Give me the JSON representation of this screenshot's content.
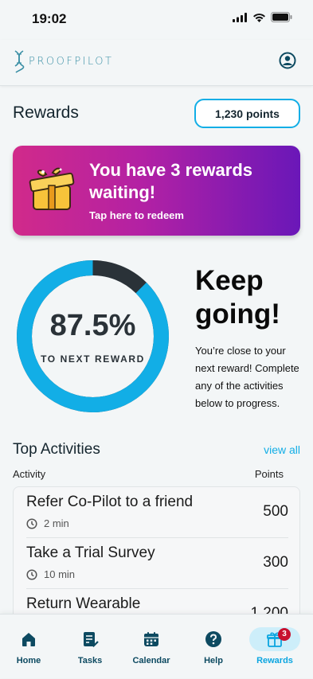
{
  "status_bar": {
    "time": "19:02",
    "icons": [
      "cellular-icon",
      "wifi-icon",
      "battery-icon"
    ]
  },
  "app_bar": {
    "logo_text": "PROOFPILOT",
    "profile_icon": "profile-icon"
  },
  "rewards": {
    "title": "Rewards",
    "points": "1,230 points"
  },
  "banner": {
    "title": "You have 3 rewards waiting!",
    "subtitle": "Tap here to redeem",
    "icon": "gift-icon"
  },
  "progress": {
    "percent_label": "87.5%",
    "value": 0.875,
    "caption": "TO NEXT REWARD",
    "headline": "Keep going!",
    "description": "You’re close to your next reward! Complete any of the activities below to progress."
  },
  "top_activities": {
    "title": "Top Activities",
    "view_all": "view all",
    "col_activity": "Activity",
    "col_points": "Points",
    "items": [
      {
        "title": "Refer Co-Pilot to a friend",
        "time": "2 min",
        "points": "500"
      },
      {
        "title": "Take a Trial Survey",
        "time": "10 min",
        "points": "300"
      },
      {
        "title": "Return Wearable",
        "time": "",
        "points": "1,200"
      }
    ]
  },
  "bottom_nav": {
    "items": [
      {
        "label": "Home",
        "icon": "home-icon"
      },
      {
        "label": "Tasks",
        "icon": "tasks-icon"
      },
      {
        "label": "Calendar",
        "icon": "calendar-icon"
      },
      {
        "label": "Help",
        "icon": "help-icon"
      },
      {
        "label": "Rewards",
        "icon": "gift-icon"
      }
    ],
    "rewards_badge": "3"
  },
  "colors": {
    "accent": "#12aee6",
    "nav_text": "#0d4a61",
    "banner_start": "#d12a8a",
    "banner_end": "#6a17b8",
    "ring_fill": "#12aee6",
    "ring_remaining": "#2a3238",
    "badge": "#c8102e"
  }
}
